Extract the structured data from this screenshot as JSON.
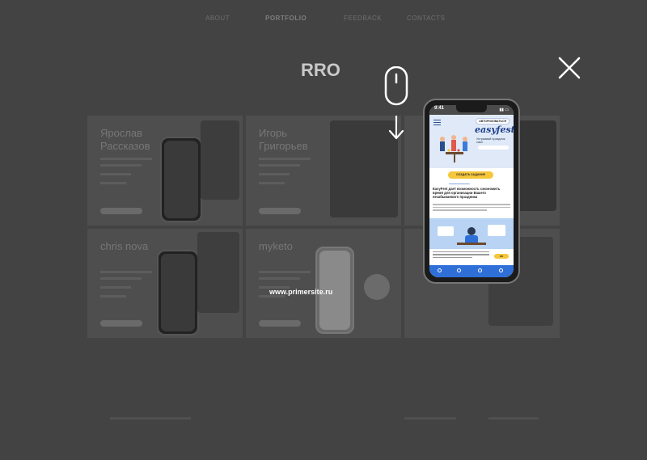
{
  "nav": {
    "items": [
      {
        "label": "ABOUT"
      },
      {
        "label": "PORTFOLIO"
      },
      {
        "label": "FEEDBACK"
      },
      {
        "label": "CONTACTS"
      }
    ]
  },
  "logo": {
    "text": "RRO"
  },
  "portfolio": {
    "cards": [
      {
        "name": "Ярослав\nРассказов"
      },
      {
        "name": "Игорь\nГригорьев"
      },
      {
        "name": "chris nova"
      },
      {
        "name": "myketo"
      }
    ]
  },
  "overlay": {
    "site_url": "www.primersite.ru",
    "close_icon": "close-icon",
    "mouse_icon": "mouse-scroll-icon"
  },
  "phone": {
    "status_time": "9:41",
    "auth_button": "АВТОРИЗОВАТЬСЯ",
    "brand": "easyfest",
    "hero_line": "Устраивай праздник сам!",
    "cta": "СОЗДАТЬ ЗАДАНИЕ",
    "heading": "EasyFest дает возможность сэкономить время для организации Вашего незабываемого праздника",
    "cookie_ok": "OK"
  },
  "colors": {
    "overlay_bg": "#434343",
    "accent_yellow": "#f6c63b",
    "app_blue": "#2f6fd8"
  }
}
